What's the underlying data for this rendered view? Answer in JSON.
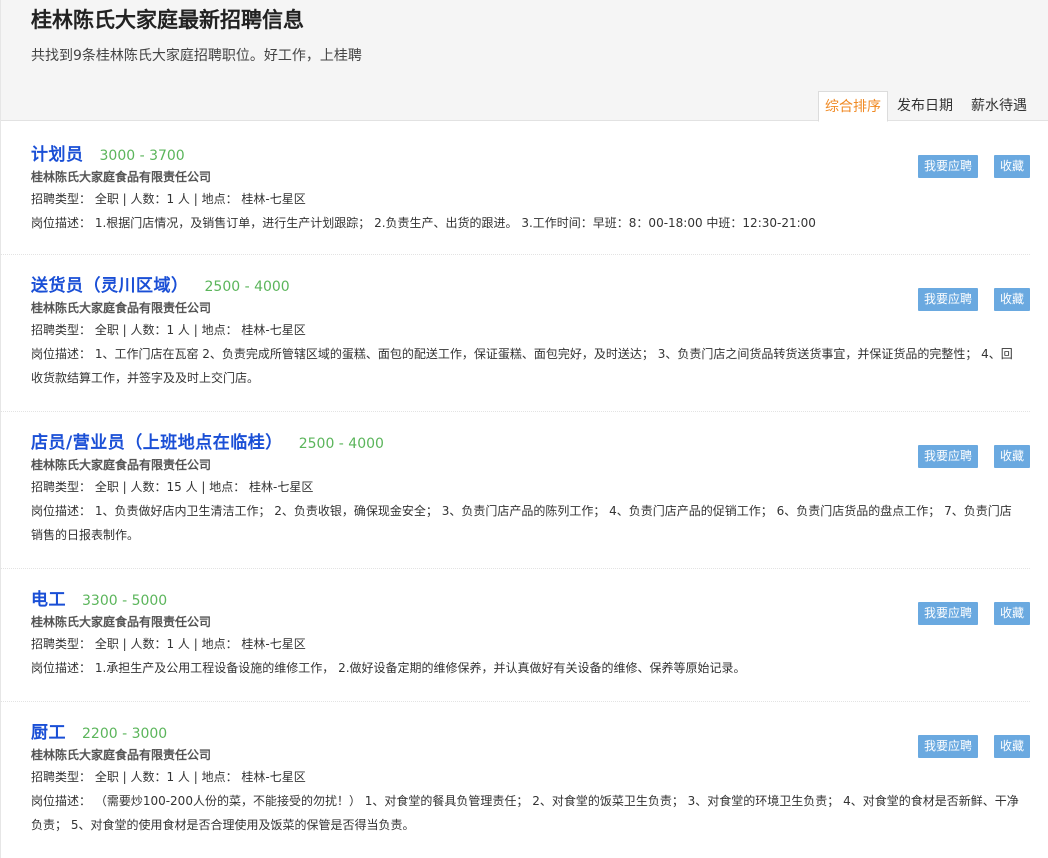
{
  "header": {
    "title": "桂林陈氏大家庭最新招聘信息",
    "subtitle": "共找到9条桂林陈氏大家庭招聘职位。好工作，上桂聘"
  },
  "sort_tabs": [
    {
      "label": "综合排序",
      "active": true
    },
    {
      "label": "发布日期",
      "active": false
    },
    {
      "label": "薪水待遇",
      "active": false
    }
  ],
  "buttons": {
    "apply": "我要应聘",
    "favorite": "收藏"
  },
  "jobs": [
    {
      "title": "计划员",
      "salary": "3000 - 3700",
      "company": "桂林陈氏大家庭食品有限责任公司",
      "meta": "招聘类型： 全职 | 人数：1 人 | 地点： 桂林-七星区",
      "desc": "岗位描述： 1.根据门店情况，及销售订单，进行生产计划跟踪； 2.负责生产、出货的跟进。 3.工作时间：早班：8：00-18:00 中班：12:30-21:00"
    },
    {
      "title": "送货员（灵川区域）",
      "salary": "2500 - 4000",
      "company": "桂林陈氏大家庭食品有限责任公司",
      "meta": "招聘类型： 全职 | 人数：1 人 | 地点： 桂林-七星区",
      "desc": "岗位描述： 1、工作门店在瓦窑 2、负责完成所管辖区域的蛋糕、面包的配送工作，保证蛋糕、面包完好，及时送达； 3、负责门店之间货品转货送货事宜，并保证货品的完整性； 4、回收货款结算工作，并签字及及时上交门店。"
    },
    {
      "title": "店员/营业员（上班地点在临桂）",
      "salary": "2500 - 4000",
      "company": "桂林陈氏大家庭食品有限责任公司",
      "meta": "招聘类型： 全职 | 人数：15 人 | 地点： 桂林-七星区",
      "desc": "岗位描述： 1、负责做好店内卫生清洁工作； 2、负责收银，确保现金安全； 3、负责门店产品的陈列工作； 4、负责门店产品的促销工作； 6、负责门店货品的盘点工作； 7、负责门店销售的日报表制作。"
    },
    {
      "title": "电工",
      "salary": "3300 - 5000",
      "company": "桂林陈氏大家庭食品有限责任公司",
      "meta": "招聘类型： 全职 | 人数：1 人 | 地点： 桂林-七星区",
      "desc": "岗位描述： 1.承担生产及公用工程设备设施的维修工作， 2.做好设备定期的维修保养，并认真做好有关设备的维修、保养等原始记录。"
    },
    {
      "title": "厨工",
      "salary": "2200 - 3000",
      "company": "桂林陈氏大家庭食品有限责任公司",
      "meta": "招聘类型： 全职 | 人数：1 人 | 地点： 桂林-七星区",
      "desc": "岗位描述： （需要炒100-200人份的菜，不能接受的勿扰！） 1、对食堂的餐具负管理责任； 2、对食堂的饭菜卫生负责； 3、对食堂的环境卫生负责； 4、对食堂的食材是否新鲜、干净负责； 5、对食堂的使用食材是否合理使用及饭菜的保管是否得当负责。"
    }
  ]
}
